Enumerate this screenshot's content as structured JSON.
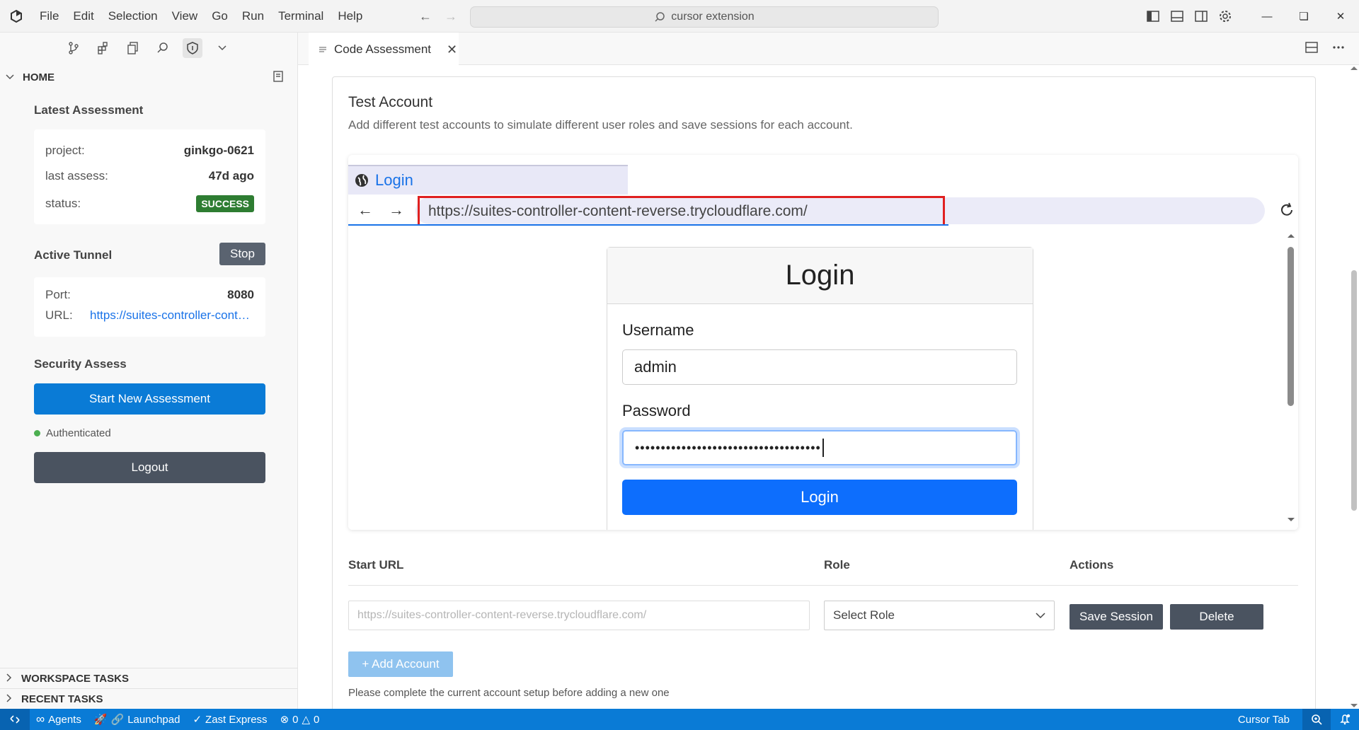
{
  "titlebar": {
    "menu": [
      "File",
      "Edit",
      "Selection",
      "View",
      "Go",
      "Run",
      "Terminal",
      "Help"
    ],
    "search_text": "cursor extension"
  },
  "sidebar": {
    "home_label": "HOME",
    "latest_assessment": {
      "title": "Latest Assessment",
      "project_label": "project:",
      "project_value": "ginkgo-0621",
      "last_assess_label": "last assess:",
      "last_assess_value": "47d ago",
      "status_label": "status:",
      "status_value": "SUCCESS"
    },
    "active_tunnel": {
      "title": "Active Tunnel",
      "stop_label": "Stop",
      "port_label": "Port:",
      "port_value": "8080",
      "url_label": "URL:",
      "url_value": "https://suites-controller-content-reverse.trycloudflare.com/"
    },
    "security_assess": {
      "title": "Security Assess",
      "start_button": "Start New Assessment",
      "auth_status": "Authenticated",
      "logout_button": "Logout"
    },
    "workspace_tasks": "WORKSPACE TASKS",
    "recent_tasks": "RECENT TASKS"
  },
  "editor": {
    "tab_label": "Code Assessment",
    "section_title": "Test Account",
    "section_desc": "Add different test accounts to simulate different user roles and save sessions for each account.",
    "browser": {
      "tab_title": "Login",
      "url": "https://suites-controller-content-reverse.trycloudflare.com/",
      "page": {
        "heading": "Login",
        "username_label": "Username",
        "username_value": "admin",
        "password_label": "Password",
        "password_value": "••••••••••••••••••••••••••••••••••••",
        "login_button": "Login"
      }
    },
    "table": {
      "col_start_url": "Start URL",
      "col_role": "Role",
      "col_actions": "Actions",
      "start_url_placeholder": "https://suites-controller-content-reverse.trycloudflare.com/",
      "role_selected": "Select Role",
      "save_session": "Save Session",
      "delete": "Delete"
    },
    "add_account": "+ Add Account",
    "hint": "Please complete the current account setup before adding a new one"
  },
  "statusbar": {
    "agents": "Agents",
    "launchpad": "Launchpad",
    "zast": "Zast Express",
    "errors": "0",
    "warnings": "0",
    "cursor_tab": "Cursor Tab"
  },
  "colors": {
    "accent": "#0a7bd6",
    "success": "#2e7d32",
    "dark_button": "#4a5360",
    "highlight_box": "#e02020"
  }
}
